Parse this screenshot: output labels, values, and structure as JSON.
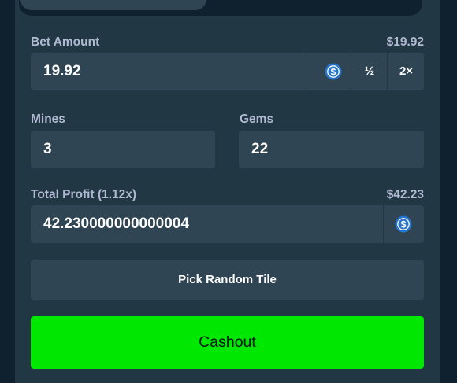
{
  "bet": {
    "label": "Bet Amount",
    "usd_value": "$19.92",
    "amount": "19.92",
    "currency_icon": "usdc-coin-icon",
    "half_label": "½",
    "double_label": "2×"
  },
  "mines": {
    "label": "Mines",
    "value": "3"
  },
  "gems": {
    "label": "Gems",
    "value": "22"
  },
  "profit": {
    "label": "Total Profit (1.12x)",
    "usd_value": "$42.23",
    "amount": "42.230000000000004",
    "currency_icon": "usdc-coin-icon"
  },
  "actions": {
    "random_tile_label": "Pick Random Tile",
    "cashout_label": "Cashout"
  },
  "colors": {
    "background": "#0f212e",
    "panel": "#213743",
    "field": "#2f4553",
    "accent_green": "#00e701",
    "coin_blue": "#2775ca"
  }
}
